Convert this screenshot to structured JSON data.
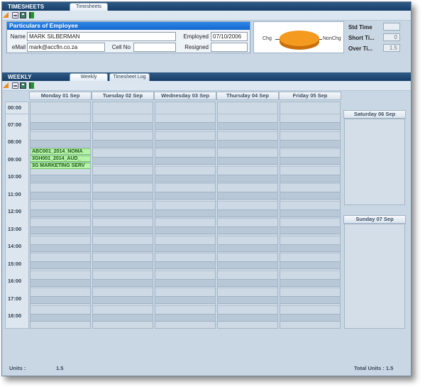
{
  "top_section": {
    "title": "TIMESHEETS",
    "tab": "Timesheets"
  },
  "employee_panel": {
    "title": "Particulars of Employee",
    "name_label": "Name",
    "name_value": "MARK SILBERMAN",
    "employed_label": "Employed",
    "employed_value": "07/10/2006",
    "email_label": "eMail",
    "email_value": "mark@accfin.co.za",
    "cellno_label": "Cell No",
    "cellno_value": "",
    "resigned_label": "Resigned",
    "resigned_value": ""
  },
  "chart": {
    "left_label": "Chg",
    "right_label": "NonChg",
    "slice_color": "#f39a1f"
  },
  "stats": {
    "std_time_label": "Std Time",
    "std_time_value": "",
    "short_time_label": "Short Ti...",
    "short_time_value": "0",
    "over_time_label": "Over Ti...",
    "over_time_value": "1.5"
  },
  "weekly_section": {
    "title": "WEEKLY",
    "tabs": [
      "Weekly",
      "Timesheet Log"
    ]
  },
  "days": [
    "Monday 01 Sep",
    "Tuesday 02 Sep",
    "Wednesday 03 Sep",
    "Thursday 04 Sep",
    "Friday 05 Sep"
  ],
  "weekend": [
    "Saturday 06 Sep",
    "Sunday 07 Sep"
  ],
  "times": [
    "00:00",
    "07:00",
    "08:00",
    "09:00",
    "10:00",
    "11:00",
    "12:00",
    "13:00",
    "14:00",
    "15:00",
    "16:00",
    "17:00",
    "18:00"
  ],
  "appointments": [
    "ABC001_2014_NOMA",
    "3GH001_2014_AUD_",
    "3G MARKETING SERV"
  ],
  "footer": {
    "units_label": "Units :",
    "units_value": "1.5",
    "total_units": "Total Units : 1.5"
  },
  "colors": {
    "header_bar": "#1e4a78",
    "panel_title": "#1b6fd6",
    "appointment": "#b7f2a9"
  }
}
